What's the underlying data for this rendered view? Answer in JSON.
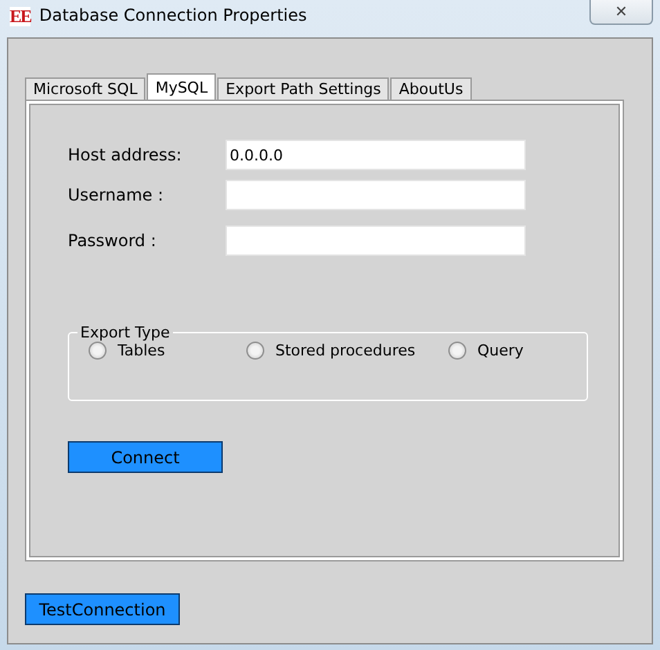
{
  "window": {
    "logo": "EE",
    "title": "Database Connection Properties",
    "close": "✕"
  },
  "tabs": [
    {
      "label": "Microsoft SQL",
      "selected": false
    },
    {
      "label": "MySQL",
      "selected": true
    },
    {
      "label": "Export Path Settings",
      "selected": false
    },
    {
      "label": "AboutUs",
      "selected": false
    }
  ],
  "fields": [
    {
      "label": "Host address:",
      "value": "0.0.0.0"
    },
    {
      "label": "Username :"
    },
    {
      "label": "Password :"
    }
  ],
  "export_type": {
    "title": "Export Type",
    "options": [
      {
        "label": "Tables",
        "selected": false
      },
      {
        "label": "Stored procedures",
        "selected": false
      },
      {
        "label": "Query",
        "selected": false
      }
    ]
  },
  "connect_button": "Connect",
  "test_button": "TestConnection"
}
